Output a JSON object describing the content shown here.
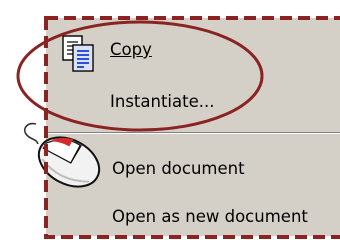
{
  "context_menu": {
    "items": [
      {
        "label": "Copy",
        "icon": "copy-icon"
      },
      {
        "label": "Instantiate..."
      },
      {
        "label": "Open document"
      },
      {
        "label": "Open as new document"
      }
    ]
  },
  "highlight": {
    "circle_color": "#8b2323",
    "border_color": "#8b2323",
    "border_style": "dashed"
  },
  "decor": {
    "mouse_icon": "mouse-left-click-icon"
  }
}
